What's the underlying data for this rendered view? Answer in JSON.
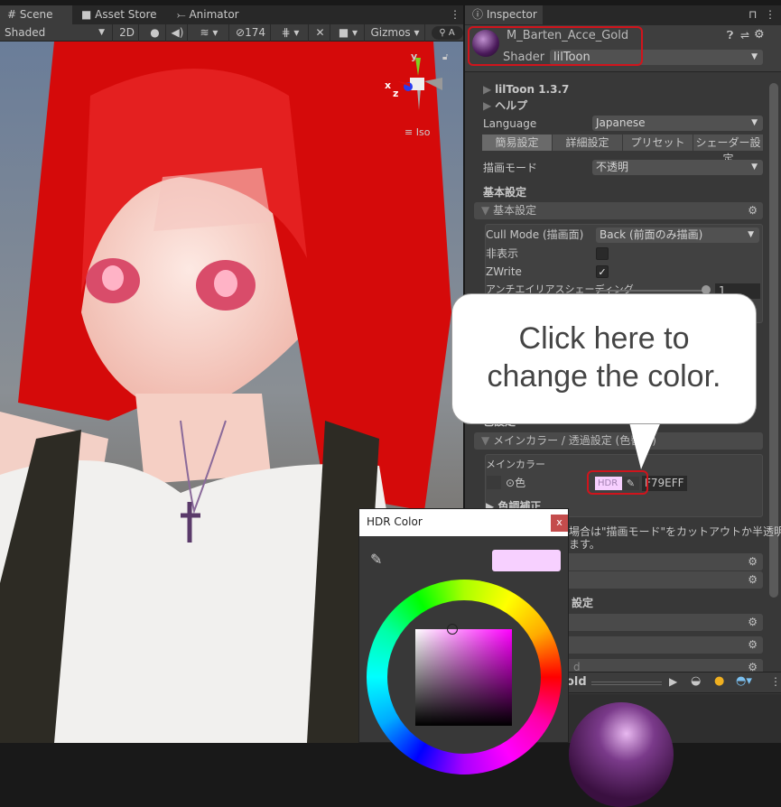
{
  "scene_tabs": [
    {
      "label": "Scene",
      "icon": "grid-icon"
    },
    {
      "label": "Asset Store",
      "icon": "bag-icon"
    },
    {
      "label": "Animator",
      "icon": "animator-icon"
    }
  ],
  "toolbar": {
    "shading_mode": "Shaded",
    "mode_2d": "2D",
    "hidden_count": "174",
    "gizmos": "Gizmos",
    "search_placeholder": "A"
  },
  "gizmo": {
    "y": "y",
    "x": "x",
    "z": "z",
    "projection": "Iso"
  },
  "inspector": {
    "tab": "Inspector",
    "material_name": "M_Barten_Acce_Gold",
    "shader_label": "Shader",
    "shader_value": "lilToon",
    "version": "lilToon 1.3.7",
    "help": "ヘルプ",
    "language_label": "Language",
    "language_value": "Japanese",
    "mode_tabs": [
      "簡易設定",
      "詳細設定",
      "プリセット",
      "シェーダー設定"
    ],
    "render_mode_label": "描画モード",
    "render_mode_value": "不透明",
    "basic_heading": "基本設定",
    "basic_foldout": "基本設定",
    "cull_label": "Cull Mode (描画面)",
    "cull_value": "Back (前面のみ描画)",
    "hide_label": "非表示",
    "zwrite_label": "ZWrite",
    "aa_label": "アンチエイリアスシェーディング",
    "aa_value": "1",
    "zwrite_checked": true,
    "hide_checked": false,
    "color_settings_partial": "色設定",
    "main_color_foldout": "メインカラー / 透過設定 (色替え)",
    "main_color_box": "メインカラー",
    "color_label": "色",
    "hdr_label": "HDR",
    "color_hex": "F79EFF",
    "color_swatch": "#f7d0ff",
    "tone_label": "色調補正",
    "note_line1": "場合は\"描画モード\"をカットアウトか半透明に",
    "note_line2": "ます。",
    "section2_partial": "設定",
    "foldout_partial": "d",
    "preview_name_partial": "old"
  },
  "callout": {
    "line1": "Click here to",
    "line2": "change the color."
  },
  "hdr_window": {
    "title": "HDR Color",
    "close": "x",
    "current_color": "#f7d0ff"
  },
  "colors": {
    "highlight": "#d0141c",
    "accent_pink": "#f79eff"
  }
}
